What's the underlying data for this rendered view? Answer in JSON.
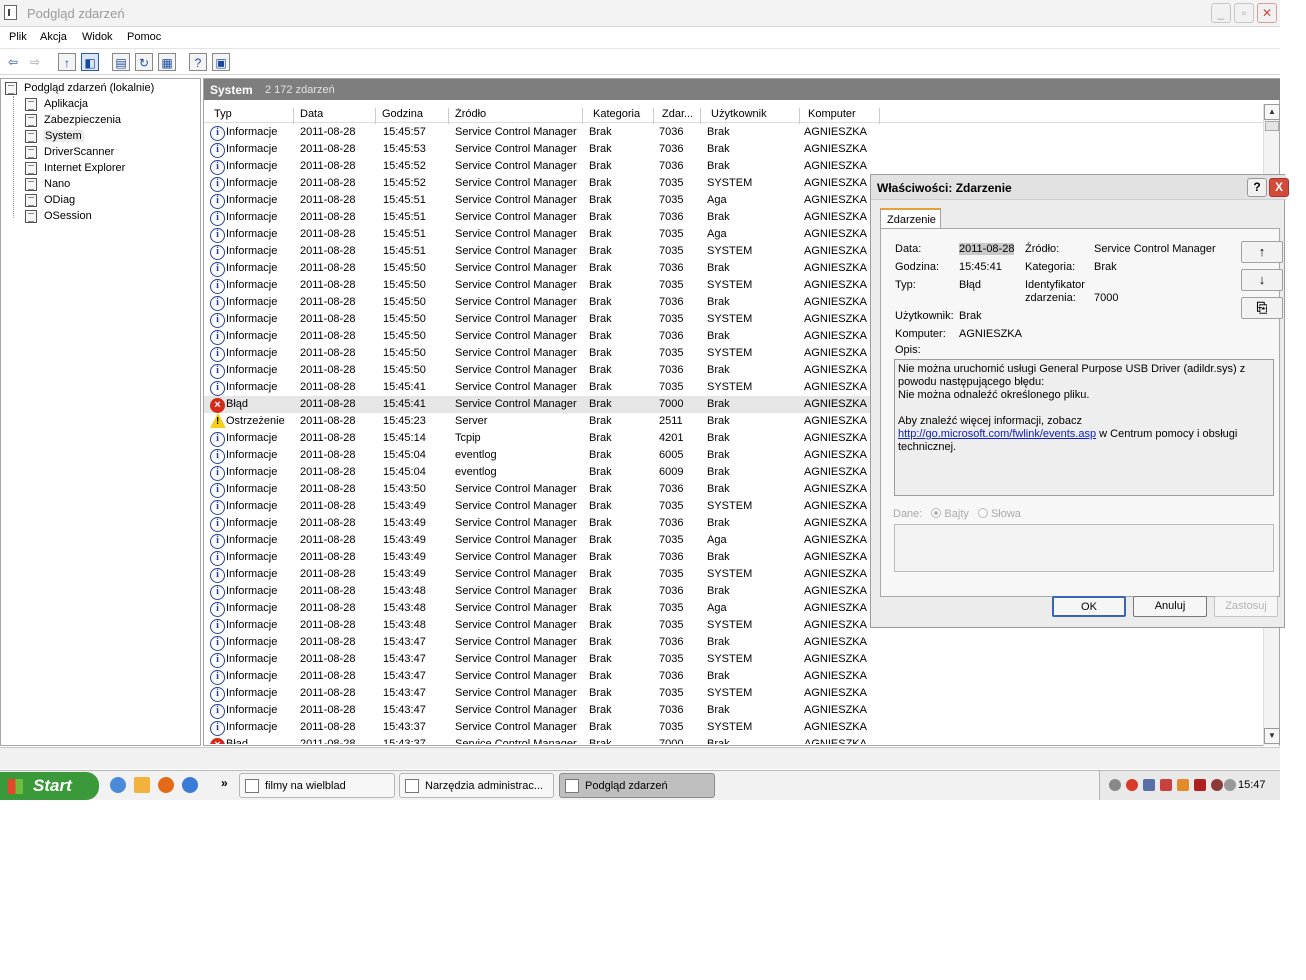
{
  "window": {
    "title": "Podgląd zdarzeń"
  },
  "menu": [
    "Plik",
    "Akcja",
    "Widok",
    "Pomoc"
  ],
  "tree": {
    "root": "Podgląd zdarzeń (lokalnie)",
    "items": [
      "Aplikacja",
      "Zabezpieczenia",
      "System",
      "DriverScanner",
      "Internet Explorer",
      "Nano",
      "ODiag",
      "OSession"
    ],
    "selected": "System"
  },
  "panel": {
    "title": "System",
    "count": "2 172 zdarzeń"
  },
  "columns": [
    "Typ",
    "Data",
    "Godzina",
    "Źródło",
    "Kategoria",
    "Zdar...",
    "Użytkownik",
    "Komputer"
  ],
  "events": [
    {
      "icon": "info",
      "type": "Informacje",
      "date": "2011-08-28",
      "time": "15:45:57",
      "source": "Service Control Manager",
      "category": "Brak",
      "id": "7036",
      "user": "Brak",
      "computer": "AGNIESZKA"
    },
    {
      "icon": "info",
      "type": "Informacje",
      "date": "2011-08-28",
      "time": "15:45:53",
      "source": "Service Control Manager",
      "category": "Brak",
      "id": "7036",
      "user": "Brak",
      "computer": "AGNIESZKA"
    },
    {
      "icon": "info",
      "type": "Informacje",
      "date": "2011-08-28",
      "time": "15:45:52",
      "source": "Service Control Manager",
      "category": "Brak",
      "id": "7036",
      "user": "Brak",
      "computer": "AGNIESZKA"
    },
    {
      "icon": "info",
      "type": "Informacje",
      "date": "2011-08-28",
      "time": "15:45:52",
      "source": "Service Control Manager",
      "category": "Brak",
      "id": "7035",
      "user": "SYSTEM",
      "computer": "AGNIESZKA"
    },
    {
      "icon": "info",
      "type": "Informacje",
      "date": "2011-08-28",
      "time": "15:45:51",
      "source": "Service Control Manager",
      "category": "Brak",
      "id": "7035",
      "user": "Aga",
      "computer": "AGNIESZKA"
    },
    {
      "icon": "info",
      "type": "Informacje",
      "date": "2011-08-28",
      "time": "15:45:51",
      "source": "Service Control Manager",
      "category": "Brak",
      "id": "7036",
      "user": "Brak",
      "computer": "AGNIESZKA"
    },
    {
      "icon": "info",
      "type": "Informacje",
      "date": "2011-08-28",
      "time": "15:45:51",
      "source": "Service Control Manager",
      "category": "Brak",
      "id": "7035",
      "user": "Aga",
      "computer": "AGNIESZKA"
    },
    {
      "icon": "info",
      "type": "Informacje",
      "date": "2011-08-28",
      "time": "15:45:51",
      "source": "Service Control Manager",
      "category": "Brak",
      "id": "7035",
      "user": "SYSTEM",
      "computer": "AGNIESZKA"
    },
    {
      "icon": "info",
      "type": "Informacje",
      "date": "2011-08-28",
      "time": "15:45:50",
      "source": "Service Control Manager",
      "category": "Brak",
      "id": "7036",
      "user": "Brak",
      "computer": "AGNIESZKA"
    },
    {
      "icon": "info",
      "type": "Informacje",
      "date": "2011-08-28",
      "time": "15:45:50",
      "source": "Service Control Manager",
      "category": "Brak",
      "id": "7035",
      "user": "SYSTEM",
      "computer": "AGNIESZKA"
    },
    {
      "icon": "info",
      "type": "Informacje",
      "date": "2011-08-28",
      "time": "15:45:50",
      "source": "Service Control Manager",
      "category": "Brak",
      "id": "7036",
      "user": "Brak",
      "computer": "AGNIESZKA"
    },
    {
      "icon": "info",
      "type": "Informacje",
      "date": "2011-08-28",
      "time": "15:45:50",
      "source": "Service Control Manager",
      "category": "Brak",
      "id": "7035",
      "user": "SYSTEM",
      "computer": "AGNIESZKA"
    },
    {
      "icon": "info",
      "type": "Informacje",
      "date": "2011-08-28",
      "time": "15:45:50",
      "source": "Service Control Manager",
      "category": "Brak",
      "id": "7036",
      "user": "Brak",
      "computer": "AGNIESZKA"
    },
    {
      "icon": "info",
      "type": "Informacje",
      "date": "2011-08-28",
      "time": "15:45:50",
      "source": "Service Control Manager",
      "category": "Brak",
      "id": "7035",
      "user": "SYSTEM",
      "computer": "AGNIESZKA"
    },
    {
      "icon": "info",
      "type": "Informacje",
      "date": "2011-08-28",
      "time": "15:45:50",
      "source": "Service Control Manager",
      "category": "Brak",
      "id": "7036",
      "user": "Brak",
      "computer": "AGNIESZKA"
    },
    {
      "icon": "info",
      "type": "Informacje",
      "date": "2011-08-28",
      "time": "15:45:41",
      "source": "Service Control Manager",
      "category": "Brak",
      "id": "7035",
      "user": "SYSTEM",
      "computer": "AGNIESZKA"
    },
    {
      "icon": "err",
      "type": "Błąd",
      "date": "2011-08-28",
      "time": "15:45:41",
      "source": "Service Control Manager",
      "category": "Brak",
      "id": "7000",
      "user": "Brak",
      "computer": "AGNIESZKA",
      "selected": true
    },
    {
      "icon": "warn",
      "type": "Ostrzeżenie",
      "date": "2011-08-28",
      "time": "15:45:23",
      "source": "Server",
      "category": "Brak",
      "id": "2511",
      "user": "Brak",
      "computer": "AGNIESZKA"
    },
    {
      "icon": "info",
      "type": "Informacje",
      "date": "2011-08-28",
      "time": "15:45:14",
      "source": "Tcpip",
      "category": "Brak",
      "id": "4201",
      "user": "Brak",
      "computer": "AGNIESZKA"
    },
    {
      "icon": "info",
      "type": "Informacje",
      "date": "2011-08-28",
      "time": "15:45:04",
      "source": "eventlog",
      "category": "Brak",
      "id": "6005",
      "user": "Brak",
      "computer": "AGNIESZKA"
    },
    {
      "icon": "info",
      "type": "Informacje",
      "date": "2011-08-28",
      "time": "15:45:04",
      "source": "eventlog",
      "category": "Brak",
      "id": "6009",
      "user": "Brak",
      "computer": "AGNIESZKA"
    },
    {
      "icon": "info",
      "type": "Informacje",
      "date": "2011-08-28",
      "time": "15:43:50",
      "source": "Service Control Manager",
      "category": "Brak",
      "id": "7036",
      "user": "Brak",
      "computer": "AGNIESZKA"
    },
    {
      "icon": "info",
      "type": "Informacje",
      "date": "2011-08-28",
      "time": "15:43:49",
      "source": "Service Control Manager",
      "category": "Brak",
      "id": "7035",
      "user": "SYSTEM",
      "computer": "AGNIESZKA"
    },
    {
      "icon": "info",
      "type": "Informacje",
      "date": "2011-08-28",
      "time": "15:43:49",
      "source": "Service Control Manager",
      "category": "Brak",
      "id": "7036",
      "user": "Brak",
      "computer": "AGNIESZKA"
    },
    {
      "icon": "info",
      "type": "Informacje",
      "date": "2011-08-28",
      "time": "15:43:49",
      "source": "Service Control Manager",
      "category": "Brak",
      "id": "7035",
      "user": "Aga",
      "computer": "AGNIESZKA"
    },
    {
      "icon": "info",
      "type": "Informacje",
      "date": "2011-08-28",
      "time": "15:43:49",
      "source": "Service Control Manager",
      "category": "Brak",
      "id": "7036",
      "user": "Brak",
      "computer": "AGNIESZKA"
    },
    {
      "icon": "info",
      "type": "Informacje",
      "date": "2011-08-28",
      "time": "15:43:49",
      "source": "Service Control Manager",
      "category": "Brak",
      "id": "7035",
      "user": "SYSTEM",
      "computer": "AGNIESZKA"
    },
    {
      "icon": "info",
      "type": "Informacje",
      "date": "2011-08-28",
      "time": "15:43:48",
      "source": "Service Control Manager",
      "category": "Brak",
      "id": "7036",
      "user": "Brak",
      "computer": "AGNIESZKA"
    },
    {
      "icon": "info",
      "type": "Informacje",
      "date": "2011-08-28",
      "time": "15:43:48",
      "source": "Service Control Manager",
      "category": "Brak",
      "id": "7035",
      "user": "Aga",
      "computer": "AGNIESZKA"
    },
    {
      "icon": "info",
      "type": "Informacje",
      "date": "2011-08-28",
      "time": "15:43:48",
      "source": "Service Control Manager",
      "category": "Brak",
      "id": "7035",
      "user": "SYSTEM",
      "computer": "AGNIESZKA"
    },
    {
      "icon": "info",
      "type": "Informacje",
      "date": "2011-08-28",
      "time": "15:43:47",
      "source": "Service Control Manager",
      "category": "Brak",
      "id": "7036",
      "user": "Brak",
      "computer": "AGNIESZKA"
    },
    {
      "icon": "info",
      "type": "Informacje",
      "date": "2011-08-28",
      "time": "15:43:47",
      "source": "Service Control Manager",
      "category": "Brak",
      "id": "7035",
      "user": "SYSTEM",
      "computer": "AGNIESZKA"
    },
    {
      "icon": "info",
      "type": "Informacje",
      "date": "2011-08-28",
      "time": "15:43:47",
      "source": "Service Control Manager",
      "category": "Brak",
      "id": "7036",
      "user": "Brak",
      "computer": "AGNIESZKA"
    },
    {
      "icon": "info",
      "type": "Informacje",
      "date": "2011-08-28",
      "time": "15:43:47",
      "source": "Service Control Manager",
      "category": "Brak",
      "id": "7035",
      "user": "SYSTEM",
      "computer": "AGNIESZKA"
    },
    {
      "icon": "info",
      "type": "Informacje",
      "date": "2011-08-28",
      "time": "15:43:47",
      "source": "Service Control Manager",
      "category": "Brak",
      "id": "7036",
      "user": "Brak",
      "computer": "AGNIESZKA"
    },
    {
      "icon": "info",
      "type": "Informacje",
      "date": "2011-08-28",
      "time": "15:43:37",
      "source": "Service Control Manager",
      "category": "Brak",
      "id": "7035",
      "user": "SYSTEM",
      "computer": "AGNIESZKA"
    },
    {
      "icon": "err",
      "type": "Błąd",
      "date": "2011-08-28",
      "time": "15:43:37",
      "source": "Service Control Manager",
      "category": "Brak",
      "id": "7000",
      "user": "Brak",
      "computer": "AGNIESZKA"
    }
  ],
  "dialog": {
    "title": "Właściwości: Zdarzenie",
    "tab": "Zdarzenie",
    "labels": {
      "date": "Data:",
      "time": "Godzina:",
      "type": "Typ:",
      "user": "Użytkownik:",
      "computer": "Komputer:",
      "source": "Źródło:",
      "category": "Kategoria:",
      "event_id_1": "Identyfikator",
      "event_id_2": "zdarzenia:",
      "description": "Opis:",
      "data": "Dane:",
      "bytes": "Bajty",
      "words": "Słowa"
    },
    "values": {
      "date": "2011-08-28",
      "time": "15:45:41",
      "type": "Błąd",
      "user": "Brak",
      "computer": "AGNIESZKA",
      "source": "Service Control Manager",
      "category": "Brak",
      "event_id": "7000"
    },
    "description": {
      "line1": "Nie można uruchomić usługi General Purpose USB Driver (adildr.sys) z powodu następującego błędu:",
      "line2": "Nie można odnaleźć określonego pliku.",
      "line3": "Aby znaleźć więcej informacji, zobacz",
      "link": "http://go.microsoft.com/fwlink/events.asp",
      "line4": " w Centrum pomocy i obsługi technicznej."
    },
    "buttons": {
      "ok": "OK",
      "cancel": "Anuluj",
      "apply": "Zastosuj",
      "help": "?",
      "close": "X"
    }
  },
  "taskbar": {
    "start": "Start",
    "tasks": [
      "filmy na wielblad",
      "Narzędzia administrac...",
      "Podgląd zdarzeń"
    ],
    "active_task": "Podgląd zdarzeń",
    "clock": "15:47"
  }
}
